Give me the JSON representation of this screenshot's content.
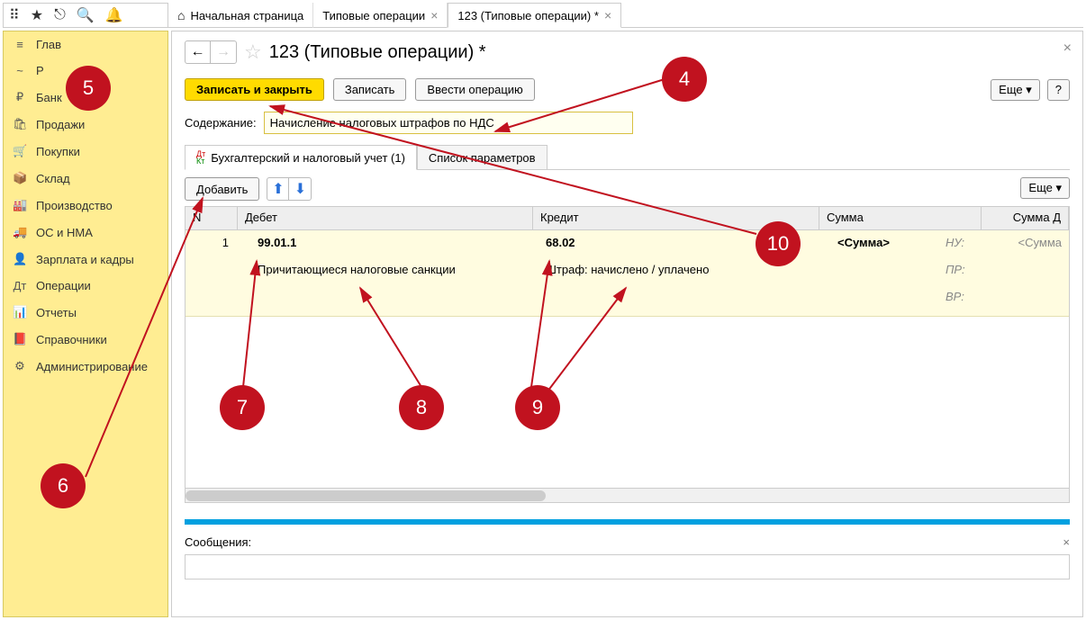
{
  "tabs": {
    "home": "Начальная страница",
    "tab1": "Типовые операции",
    "tab2": "123 (Типовые операции) *"
  },
  "sidebar": {
    "items": [
      {
        "label": "Глав",
        "icon": "≡"
      },
      {
        "label": "Р",
        "icon": "~"
      },
      {
        "label": "Банк",
        "icon": "₽"
      },
      {
        "label": "Продажи",
        "icon": "🛍"
      },
      {
        "label": "Покупки",
        "icon": "🛒"
      },
      {
        "label": "Склад",
        "icon": "📦"
      },
      {
        "label": "Производство",
        "icon": "🏭"
      },
      {
        "label": "ОС и НМА",
        "icon": "🚚"
      },
      {
        "label": "Зарплата и кадры",
        "icon": "👤"
      },
      {
        "label": "Операции",
        "icon": "Дт"
      },
      {
        "label": "Отчеты",
        "icon": "📊"
      },
      {
        "label": "Справочники",
        "icon": "📕"
      },
      {
        "label": "Администрирование",
        "icon": "⚙"
      }
    ]
  },
  "page": {
    "title": "123 (Типовые операции) *",
    "buttons": {
      "save_close": "Записать и закрыть",
      "save": "Записать",
      "enter_op": "Ввести операцию",
      "more": "Еще",
      "help": "?"
    },
    "content_label": "Содержание:",
    "content_value": "Начисление налоговых штрафов по НДС",
    "inner_tabs": {
      "acct": "Бухгалтерский и налоговый учет (1)",
      "params": "Список параметров"
    },
    "add_button": "Добавить"
  },
  "grid": {
    "headers": {
      "n": "N",
      "debit": "Дебет",
      "credit": "Кредит",
      "sum": "Сумма",
      "sumd": "Сумма Д"
    },
    "row1": {
      "n": "1",
      "debit_acc": "99.01.1",
      "debit_desc": "Причитающиеся налоговые санкции",
      "credit_acc": "68.02",
      "credit_desc": "Штраф: начислено / уплачено",
      "sum": "<Сумма>",
      "nu": "НУ:",
      "pr": "ПР:",
      "vr": "ВР:",
      "sumd": "<Сумма"
    }
  },
  "messages": {
    "label": "Сообщения:"
  },
  "badges": {
    "b4": "4",
    "b5": "5",
    "b6": "6",
    "b7": "7",
    "b8": "8",
    "b9": "9",
    "b10": "10"
  }
}
